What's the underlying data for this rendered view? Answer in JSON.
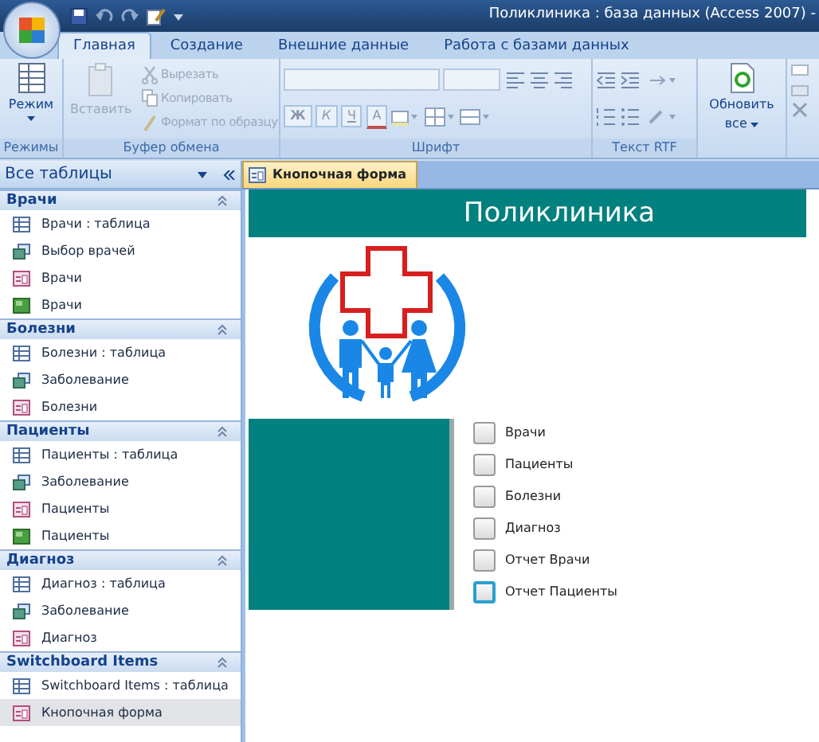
{
  "window": {
    "title": "Поликлиника : база данных (Access 2007) -"
  },
  "ribbon_tabs": [
    {
      "label": "Главная",
      "selected": true
    },
    {
      "label": "Создание",
      "selected": false
    },
    {
      "label": "Внешние данные",
      "selected": false
    },
    {
      "label": "Работа с базами данных",
      "selected": false
    }
  ],
  "ribbon": {
    "views": {
      "label": "Режимы",
      "button": "Режим"
    },
    "clipboard": {
      "label": "Буфер обмена",
      "paste": "Вставить",
      "disabled": true,
      "small_buttons": [
        "Вырезать",
        "Копировать",
        "Формат по образцу"
      ]
    },
    "font": {
      "label": "Шрифт",
      "disabled": true,
      "format_buttons": [
        "Ж",
        "К",
        "Ч",
        "А"
      ]
    },
    "rich_text": {
      "label": "Текст RTF"
    },
    "refresh": {
      "label": "Обновить",
      "sublabel": "все"
    }
  },
  "navigation": {
    "title": "Все таблицы",
    "groups": [
      {
        "label": "Врачи",
        "expanded": true,
        "items": [
          {
            "label": "Врачи : таблица",
            "kind": "table",
            "selected": false
          },
          {
            "label": "Выбор врачей",
            "kind": "query",
            "selected": false
          },
          {
            "label": "Врачи",
            "kind": "form",
            "selected": false
          },
          {
            "label": "Врачи",
            "kind": "report",
            "selected": false
          }
        ]
      },
      {
        "label": "Болезни",
        "expanded": true,
        "items": [
          {
            "label": "Болезни : таблица",
            "kind": "table",
            "selected": false
          },
          {
            "label": "Заболевание",
            "kind": "query",
            "selected": false
          },
          {
            "label": "Болезни",
            "kind": "form",
            "selected": false
          }
        ]
      },
      {
        "label": "Пациенты",
        "expanded": true,
        "items": [
          {
            "label": "Пациенты : таблица",
            "kind": "table",
            "selected": false
          },
          {
            "label": "Заболевание",
            "kind": "query",
            "selected": false
          },
          {
            "label": "Пациенты",
            "kind": "form",
            "selected": false
          },
          {
            "label": "Пациенты",
            "kind": "report",
            "selected": false
          }
        ]
      },
      {
        "label": "Диагноз",
        "expanded": true,
        "items": [
          {
            "label": "Диагноз : таблица",
            "kind": "table",
            "selected": false
          },
          {
            "label": "Заболевание",
            "kind": "query",
            "selected": false
          },
          {
            "label": "Диагноз",
            "kind": "form",
            "selected": false
          }
        ]
      },
      {
        "label": "Switchboard Items",
        "expanded": true,
        "items": [
          {
            "label": "Switchboard Items : таблица",
            "kind": "table",
            "selected": false
          },
          {
            "label": "Кнопочная форма",
            "kind": "form",
            "selected": true
          }
        ]
      }
    ]
  },
  "document_tab": {
    "label": "Кнопочная форма"
  },
  "form": {
    "title": "Поликлиника",
    "buttons": [
      {
        "label": "Врачи",
        "focused": false
      },
      {
        "label": "Пациенты",
        "focused": false
      },
      {
        "label": "Болезни",
        "focused": false
      },
      {
        "label": "Диагноз",
        "focused": false
      },
      {
        "label": "Отчет Врачи",
        "focused": false
      },
      {
        "label": "Отчет Пациенты",
        "focused": true
      }
    ]
  }
}
